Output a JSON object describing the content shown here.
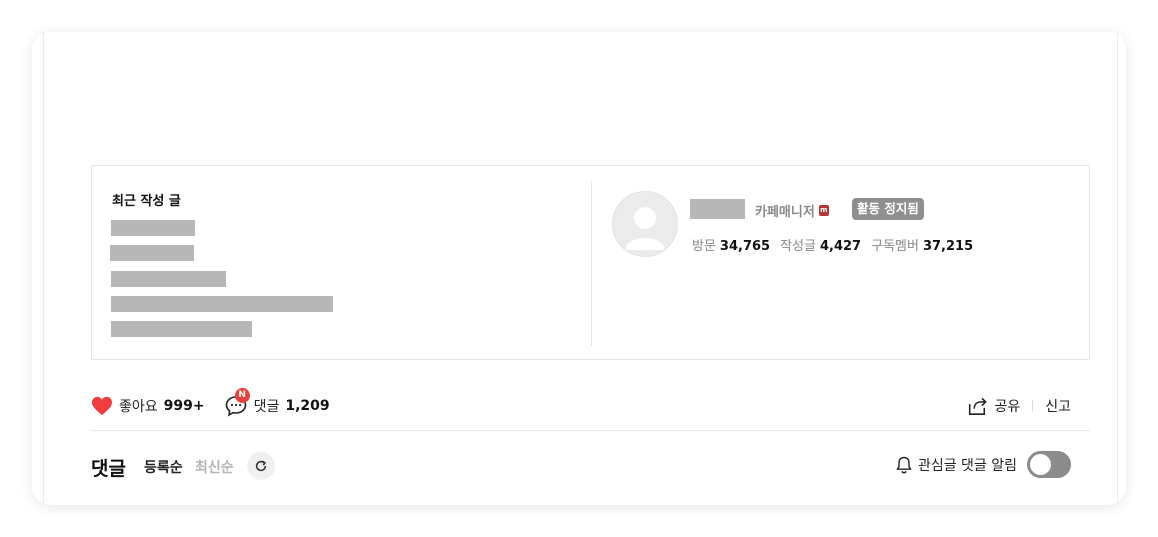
{
  "recent_posts": {
    "title": "최근 작성 글"
  },
  "profile": {
    "role": "카페매니저",
    "role_badge": "m",
    "status": "활동 정지됨",
    "stats": [
      {
        "label": "방문",
        "value": "34,765"
      },
      {
        "label": "작성글",
        "value": "4,427"
      },
      {
        "label": "구독멤버",
        "value": "37,215"
      }
    ]
  },
  "actions": {
    "like_label": "좋아요",
    "like_count": "999+",
    "comment_label": "댓글",
    "comment_count": "1,209",
    "new_badge": "N",
    "share_label": "공유",
    "report_label": "신고"
  },
  "comments": {
    "title": "댓글",
    "sort_register": "등록순",
    "sort_latest": "최신순",
    "notify_label": "관심글 댓글 알림",
    "notify_on": false
  },
  "colors": {
    "heart": "#f03c3c",
    "new_badge": "#e8413b",
    "status_badge": "#8f8f8f",
    "toggle_off": "#8b8b8b"
  }
}
